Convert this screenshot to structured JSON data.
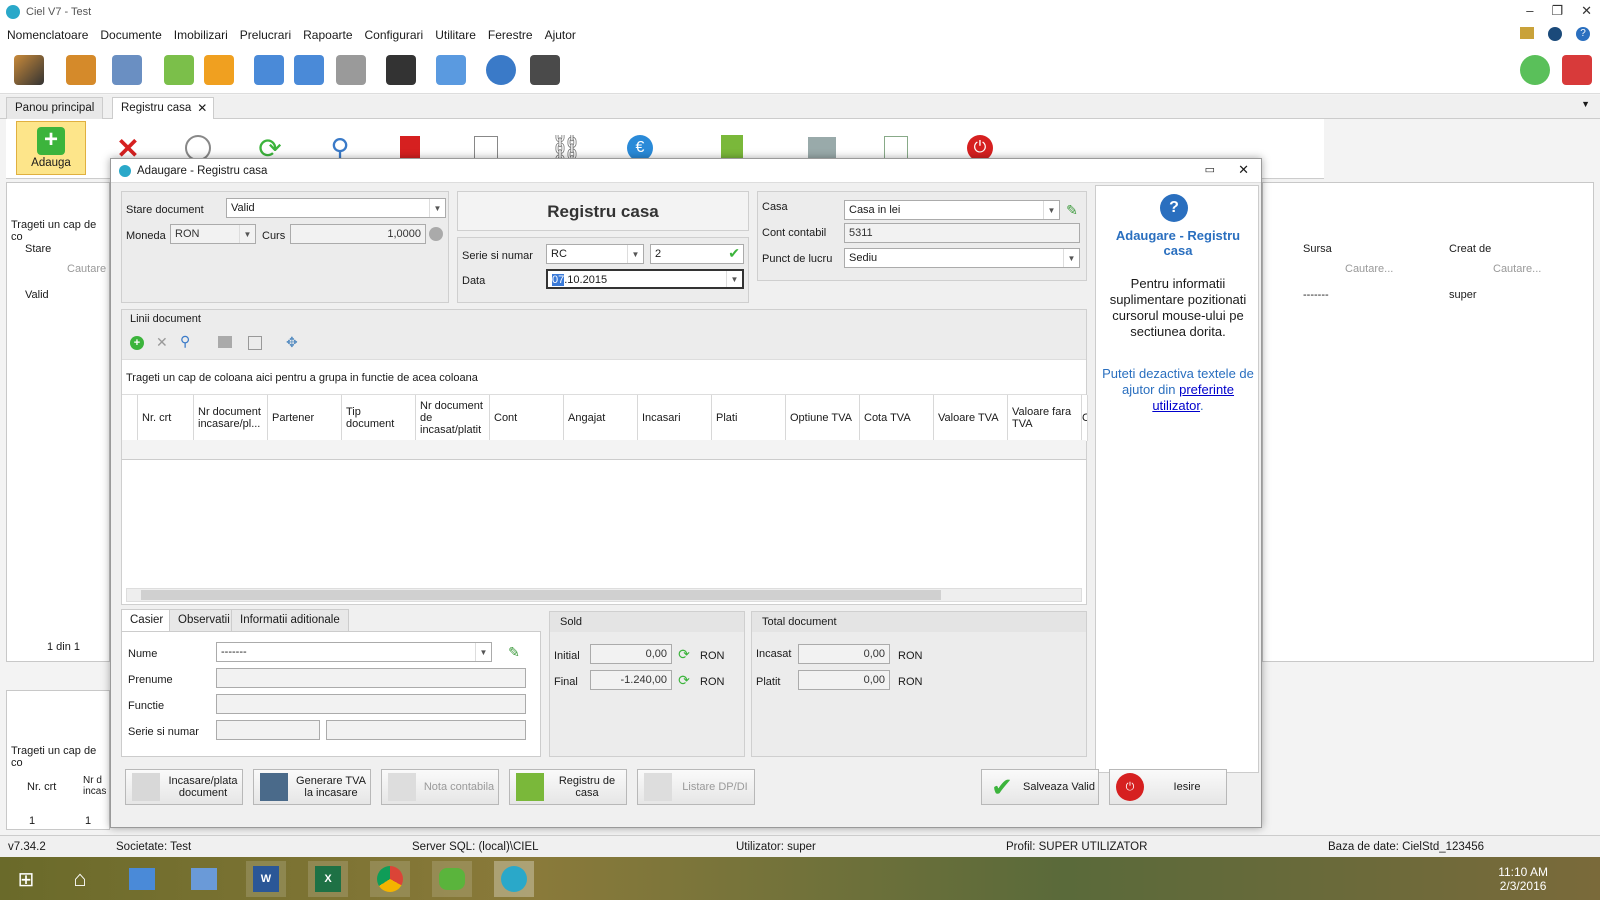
{
  "app": {
    "title": "Ciel V7 - Test"
  },
  "menu": [
    "Nomenclatoare",
    "Documente",
    "Imobilizari",
    "Prelucrari",
    "Rapoarte",
    "Configurari",
    "Utilitare",
    "Ferestre",
    "Ajutor"
  ],
  "tabs": {
    "main": "Panou principal",
    "register": "Registru casa"
  },
  "ribbon": {
    "add_label": "Adauga"
  },
  "background": {
    "group_hint": "Trageti un cap de co",
    "col_stare": "Stare",
    "search": "Cautare",
    "row_valid": "Valid",
    "col_sursa": "Sursa",
    "col_creat": "Creat de",
    "search_sursa": "Cautare...",
    "search_creat": "Cautare...",
    "row_sursa": "-------",
    "row_creat": "super",
    "pager": "1 din 1",
    "group_hint2": "Trageti un cap de co",
    "col_nrcrt": "Nr. crt",
    "col_nr": "Nr d incas",
    "row2_nrcrt": "1",
    "row2_nr": "1"
  },
  "dialog": {
    "title": "Adaugare - Registru casa",
    "stare_label": "Stare document",
    "stare_value": "Valid",
    "moneda_label": "Moneda",
    "moneda_value": "RON",
    "curs_label": "Curs",
    "curs_value": "1,0000",
    "header_title": "Registru casa",
    "serie_label": "Serie si numar",
    "serie_value": "RC",
    "numar_value": "2",
    "data_label": "Data",
    "data_value_sel": "07",
    "data_value_rest": ".10.2015",
    "casa_label": "Casa",
    "casa_value": "Casa in lei",
    "cont_label": "Cont contabil",
    "cont_value": "5311",
    "punct_label": "Punct de lucru",
    "punct_value": "Sediu",
    "lines_title": "Linii document",
    "group_hint": "Trageti un cap de coloana aici pentru a grupa in functie de acea coloana",
    "columns": [
      "Nr. crt",
      "Nr document incasare/pl...",
      "Partener",
      "Tip document",
      "Nr document de incasat/platit",
      "Cont",
      "Angajat",
      "Incasari",
      "Plati",
      "Optiune TVA",
      "Cota TVA",
      "Valoare TVA",
      "Valoare fara TVA",
      "C"
    ],
    "bottom_tabs": [
      "Casier",
      "Observatii",
      "Informatii aditionale"
    ],
    "casier": {
      "nume_label": "Nume",
      "nume_value": "-------",
      "prenume_label": "Prenume",
      "functie_label": "Functie",
      "serie_label": "Serie si numar"
    },
    "sold": {
      "title": "Sold",
      "initial_label": "Initial",
      "initial_value": "0,00",
      "final_label": "Final",
      "final_value": "-1.240,00",
      "currency": "RON"
    },
    "total": {
      "title": "Total document",
      "incasat_label": "Incasat",
      "incasat_value": "0,00",
      "platit_label": "Platit",
      "platit_value": "0,00",
      "currency": "RON"
    },
    "help": {
      "title": "Adaugare - Registru casa",
      "body": "Pentru informatii suplimentare pozitionati cursorul mouse-ului pe sectiunea dorita.",
      "hint": "Puteti dezactiva textele de ajutor din",
      "link": "preferinte utilizator",
      "dot": "."
    },
    "buttons": {
      "incasare": "Incasare/plata document",
      "generare": "Generare TVA la incasare",
      "nota": "Nota contabila",
      "registru": "Registru de casa",
      "listare": "Listare DP/DI",
      "salveaza": "Salveaza Valid",
      "iesire": "Iesire"
    }
  },
  "status": {
    "version": "v7.34.2",
    "company": "Societate: Test",
    "server": "Server SQL: (local)\\CIEL",
    "user": "Utilizator: super",
    "profile": "Profil: SUPER UTILIZATOR",
    "db": "Baza de date: CielStd_123456"
  },
  "clock": {
    "time": "11:10 AM",
    "date": "2/3/2016"
  }
}
